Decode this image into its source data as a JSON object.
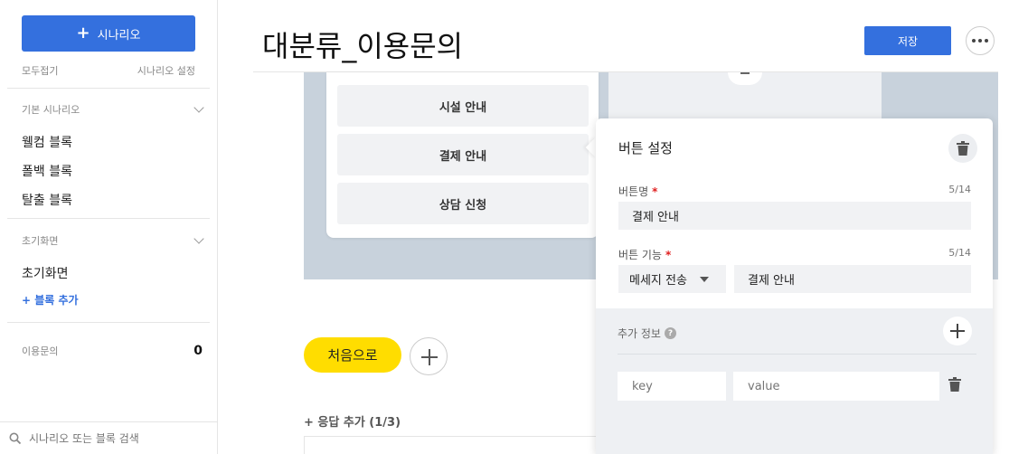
{
  "sidebar": {
    "new_scenario_label": "시나리오",
    "collapse_all": "모두접기",
    "scenario_settings": "시나리오 설정",
    "sections": [
      {
        "title": "기본 시나리오",
        "items": [
          "웰컴 블록",
          "폴백 블록",
          "탈출 블록"
        ]
      },
      {
        "title": "초기화면",
        "items": [
          "초기화면"
        ],
        "add_block": "+ 블록 추가"
      }
    ],
    "count_section": {
      "label": "이용문의",
      "count": "0"
    },
    "search_placeholder": "시나리오 또는 블록 검색"
  },
  "header": {
    "title": "대분류_이용문의",
    "save_label": "저장"
  },
  "canvas": {
    "reply_buttons": [
      "시설 안내",
      "결제 안내",
      "상담 신청"
    ],
    "first_button": "처음으로",
    "add_reply": "+ 응답 추가 (1/3)"
  },
  "popover": {
    "title": "버튼 설정",
    "name_label": "버튼명",
    "name_required": "*",
    "name_count": "5/14",
    "name_value": "결제 안내",
    "function_label": "버튼 기능",
    "function_required": "*",
    "function_count": "5/14",
    "function_select": "메세지 전송",
    "function_value": "결제 안내",
    "extra_label": "추가 정보",
    "help_glyph": "?",
    "key_placeholder": "key",
    "value_placeholder": "value"
  },
  "colors": {
    "accent": "#3470de",
    "yellow": "#ffdd00",
    "canvas_bg": "#c8d2dc",
    "required": "#e02020"
  },
  "icons": [
    "plus-icon",
    "chevron-down-icon",
    "search-icon",
    "more-icon",
    "trash-icon",
    "help-icon",
    "caret-down-icon"
  ]
}
